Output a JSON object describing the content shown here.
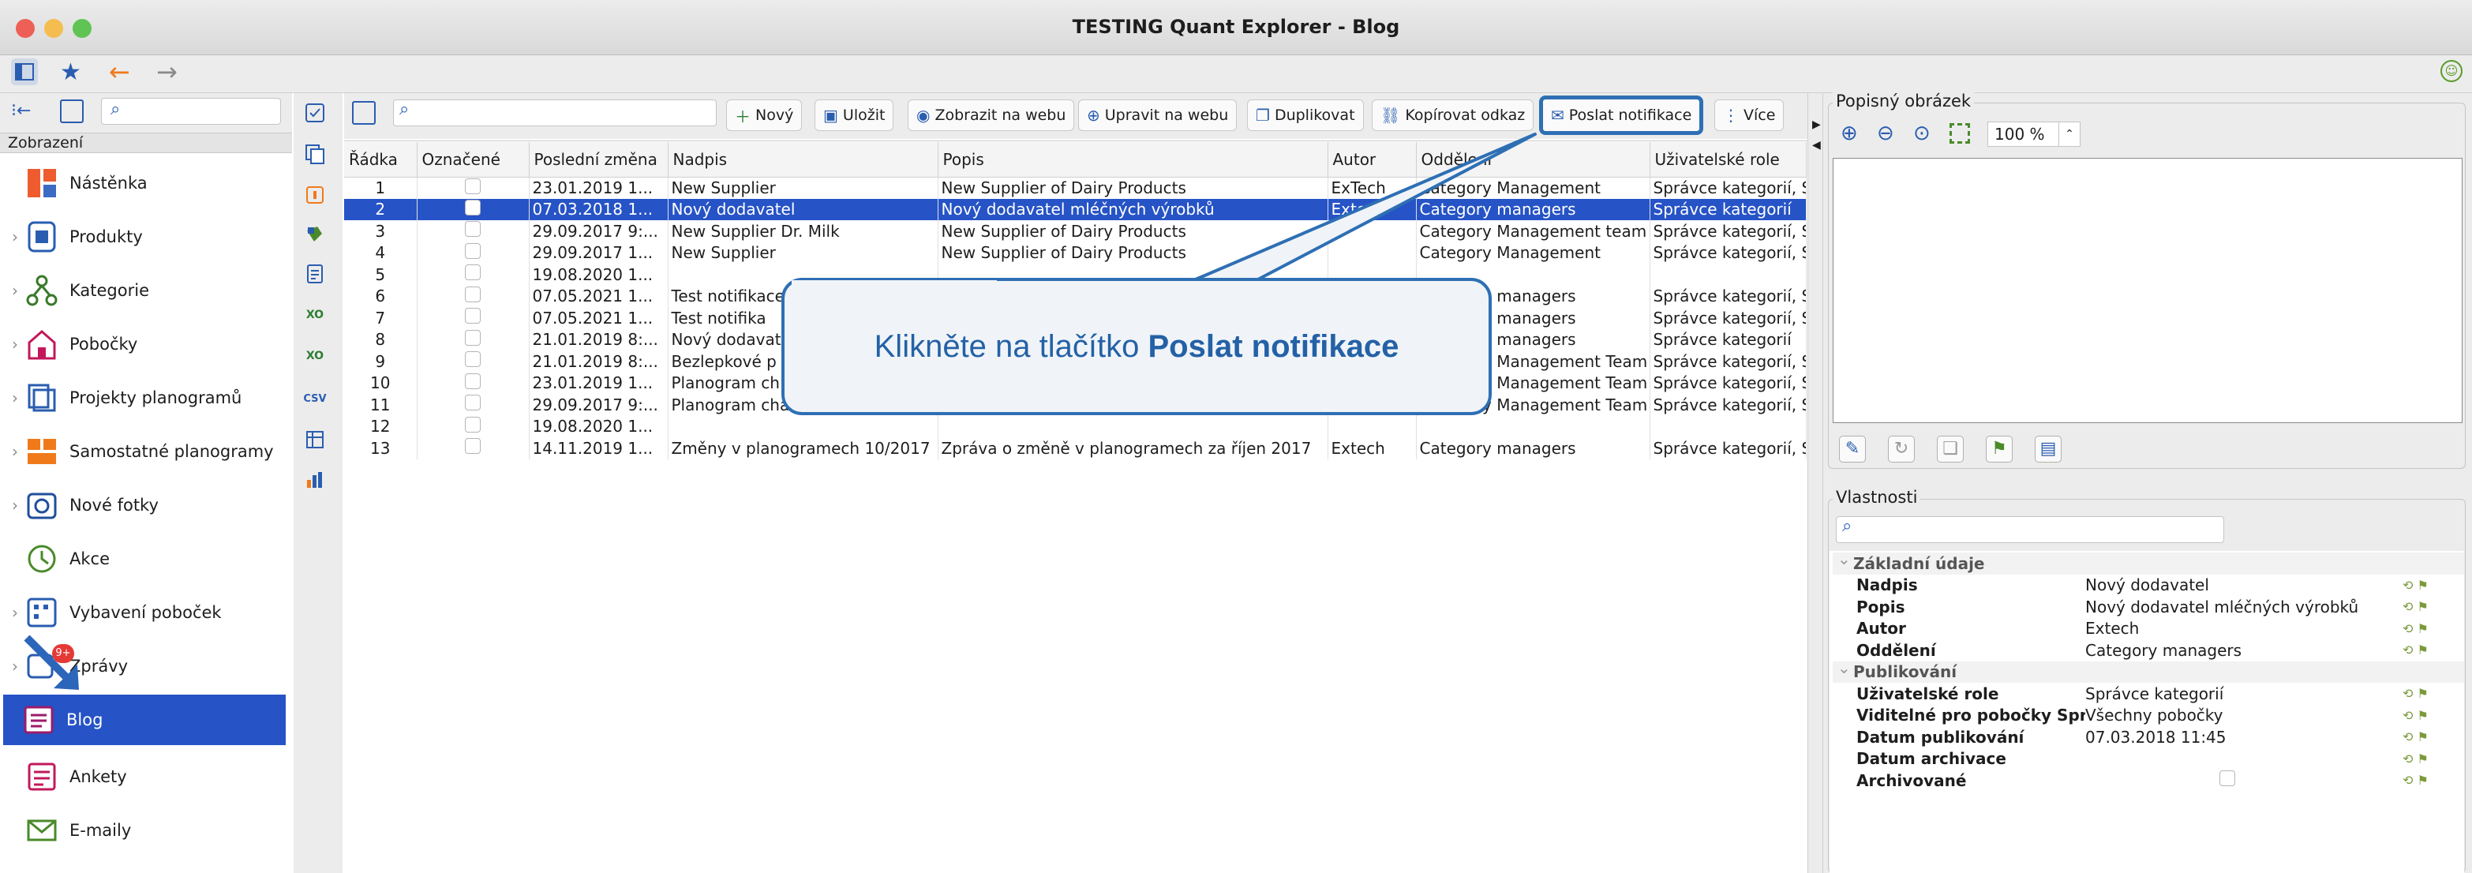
{
  "window": {
    "title": "TESTING Quant Explorer - Blog"
  },
  "nav": {
    "section_label": "Zobrazení",
    "items": [
      {
        "label": "Nástěnka"
      },
      {
        "label": "Produkty"
      },
      {
        "label": "Kategorie"
      },
      {
        "label": "Pobočky"
      },
      {
        "label": "Projekty planogramů"
      },
      {
        "label": "Samostatné planogramy"
      },
      {
        "label": "Nové fotky"
      },
      {
        "label": "Akce"
      },
      {
        "label": "Vybavení poboček"
      },
      {
        "label": "Zprávy",
        "badge": "9+"
      },
      {
        "label": "Blog"
      },
      {
        "label": "Ankety"
      },
      {
        "label": "E-maily"
      }
    ]
  },
  "toolbar": {
    "new": "Nový",
    "save": "Uložit",
    "show_web": "Zobrazit na webu",
    "edit_web": "Upravit na webu",
    "duplicate": "Duplikovat",
    "copy_link": "Kopírovat odkaz",
    "send_notif": "Poslat notifikace",
    "more": "Více"
  },
  "table": {
    "columns": [
      "Řádka",
      "Označené",
      "Poslední změna",
      "Nadpis",
      "Popis",
      "Autor",
      "Oddělení",
      "Uživatelské role"
    ],
    "rows": [
      [
        "1",
        "",
        "23.01.2019 1...",
        "New Supplier",
        "New Supplier of Dairy Products",
        "ExTech",
        "Category Management",
        "Správce kategorií, Sp"
      ],
      [
        "2",
        "",
        "07.03.2018 1...",
        "Nový dodavatel",
        "Nový dodavatel mléčných výrobků",
        "Extech",
        "Category managers",
        "Správce kategorií"
      ],
      [
        "3",
        "",
        "29.09.2017 9:...",
        "New Supplier Dr. Milk",
        "New Supplier of Dairy Products",
        "",
        "Category Management team",
        "Správce kategorií, Sp"
      ],
      [
        "4",
        "",
        "29.09.2017 1...",
        "New Supplier",
        "New Supplier of Dairy Products",
        "",
        "Category Management",
        "Správce kategorií, Sp"
      ],
      [
        "5",
        "",
        "19.08.2020 1...",
        "",
        "",
        "",
        "",
        ""
      ],
      [
        "6",
        "",
        "07.05.2021 1...",
        "Test notifikace",
        "",
        "",
        "Category managers",
        "Správce kategorií, Sp"
      ],
      [
        "7",
        "",
        "07.05.2021 1...",
        "Test notifika",
        "",
        "",
        "Category managers",
        "Správce kategorií, Sp"
      ],
      [
        "8",
        "",
        "21.01.2019 8:...",
        "Nový dodavat",
        "",
        "",
        "Category managers",
        "Správce kategorií"
      ],
      [
        "9",
        "",
        "21.01.2019 8:...",
        "Bezlepkové p",
        "",
        "",
        "Category Management Team",
        "Správce kategorií, Sp"
      ],
      [
        "10",
        "",
        "23.01.2019 1...",
        "Planogram ch",
        "",
        "",
        "Category Management Team",
        "Správce kategorií, Sp"
      ],
      [
        "11",
        "",
        "29.09.2017 9:...",
        "Planogram chan",
        "",
        "",
        "Category Management Team",
        "Správce kategorií, Sp"
      ],
      [
        "12",
        "",
        "19.08.2020 1...",
        "",
        "",
        "",
        "",
        ""
      ],
      [
        "13",
        "",
        "14.11.2019 1...",
        "Změny v planogramech 10/2017",
        "Zpráva o změně v planogramech za říjen 2017",
        "Extech",
        "Category managers",
        "Správce kategorií, Sp"
      ]
    ]
  },
  "callout": {
    "prefix": "Klikněte na tlačítko ",
    "bold": "Poslat notifikace"
  },
  "image_panel": {
    "title": "Popisný obrázek",
    "zoom": "100 %"
  },
  "props": {
    "title": "Vlastnosti",
    "groups": [
      {
        "label": "Základní údaje",
        "rows": [
          {
            "k": "Nadpis",
            "v": "Nový dodavatel"
          },
          {
            "k": "Popis",
            "v": "Nový dodavatel mléčných výrobků"
          },
          {
            "k": "Autor",
            "v": "Extech"
          },
          {
            "k": "Oddělení",
            "v": "Category managers"
          }
        ]
      },
      {
        "label": "Publikování",
        "rows": [
          {
            "k": "Uživatelské role",
            "v": "Správce kategorií"
          },
          {
            "k": "Viditelné pro pobočky Sprá...",
            "v": "Všechny pobočky"
          },
          {
            "k": "Datum publikování",
            "v": "07.03.2018 11:45"
          },
          {
            "k": "Datum archivace",
            "v": ""
          },
          {
            "k": "Archivované",
            "v": ""
          }
        ]
      }
    ]
  },
  "colors": {
    "selection": "#2653c6",
    "callout_border": "#2e6fb4",
    "callout_fill": "#f0f4f8"
  }
}
